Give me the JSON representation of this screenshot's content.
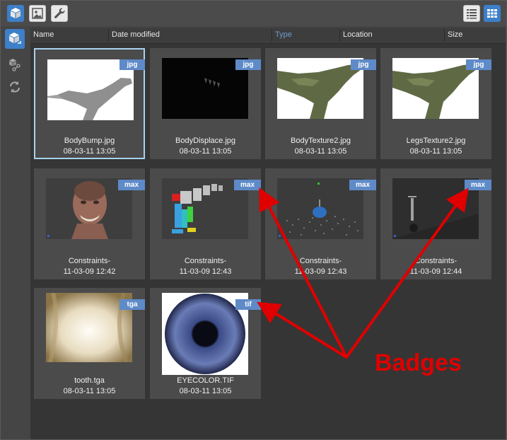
{
  "columns": [
    "Name",
    "Date modified",
    "Type",
    "Location",
    "Size"
  ],
  "sorted_column": "Type",
  "tiles": [
    {
      "name": "BodyBump.jpg",
      "date": "08-03-11 13:05",
      "badge": "jpg",
      "selected": true
    },
    {
      "name": "BodyDisplace.jpg",
      "date": "08-03-11 13:05",
      "badge": "jpg"
    },
    {
      "name": "BodyTexture2.jpg",
      "date": "08-03-11 13:05",
      "badge": "jpg"
    },
    {
      "name": "LegsTexture2.jpg",
      "date": "08-03-11 13:05",
      "badge": "jpg"
    },
    {
      "name": "Constraints-",
      "date": "11-03-09 12:42",
      "badge": "max"
    },
    {
      "name": "Constraints-",
      "date": "11-03-09 12:43",
      "badge": "max"
    },
    {
      "name": "Constraints-",
      "date": "11-03-09 12:43",
      "badge": "max"
    },
    {
      "name": "Constraints-",
      "date": "11-03-09 12:44",
      "badge": "max"
    },
    {
      "name": "tooth.tga",
      "date": "08-03-11 13:05",
      "badge": "tga"
    },
    {
      "name": "EYECOLOR.TIF",
      "date": "08-03-11 13:05",
      "badge": "tif"
    }
  ],
  "annotation": {
    "label": "Badges",
    "color": "#e00000"
  },
  "toolbar": {
    "icons": [
      "box-icon",
      "image-icon",
      "wrench-icon"
    ],
    "view_icons": [
      "list-view-icon",
      "grid-view-icon"
    ]
  },
  "sidebar": {
    "icons": [
      "assets-icon",
      "dependencies-icon",
      "sync-icon"
    ]
  },
  "colors": {
    "accent": "#3d7fc8",
    "badge": "#5e8ac8",
    "selected_border": "#a7d2ee"
  }
}
